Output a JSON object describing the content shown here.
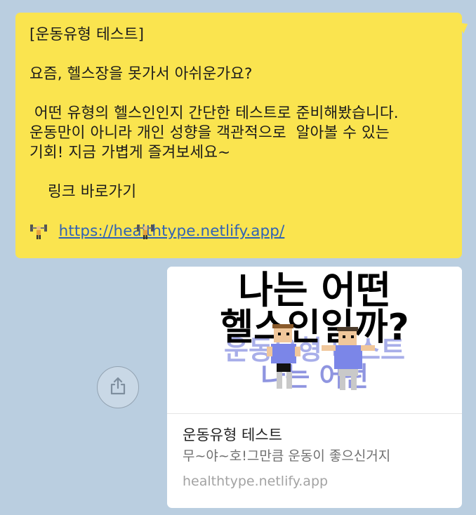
{
  "message": {
    "lines": [
      "[운동유형 테스트]",
      "",
      "요즘, 헬스장을 못가서 아쉬운가요?",
      "",
      " 어떤 유형의 헬스인인지 간단한 테스트로 준비해봤습니다.",
      "운동만이 아니라 개인 성향을 객관적으로  알아볼 수 있는",
      "기회! 지금 가볍게 즐겨보세요~",
      ""
    ],
    "link_label": "링크 바로가기",
    "link_url": "https://healthtype.netlify.app/",
    "link_icon": "weightlifter-emoji"
  },
  "share": {
    "icon": "share-icon"
  },
  "preview": {
    "image_text_line1": "나는 어떤",
    "image_text_line2": "헬스인일까?",
    "image_text_line3": "운동유형 테스트",
    "image_text_line4": "나는 어떤",
    "title": "운동유형 테스트",
    "description": "무~야~호!그만큼 운동이 좋으신거지",
    "domain": "healthtype.netlify.app"
  },
  "colors": {
    "background": "#bacee0",
    "bubble": "#fae44f",
    "link": "#2f62b6",
    "card_title": "#222222",
    "card_desc": "#707070",
    "card_domain": "#a3a3a3"
  }
}
